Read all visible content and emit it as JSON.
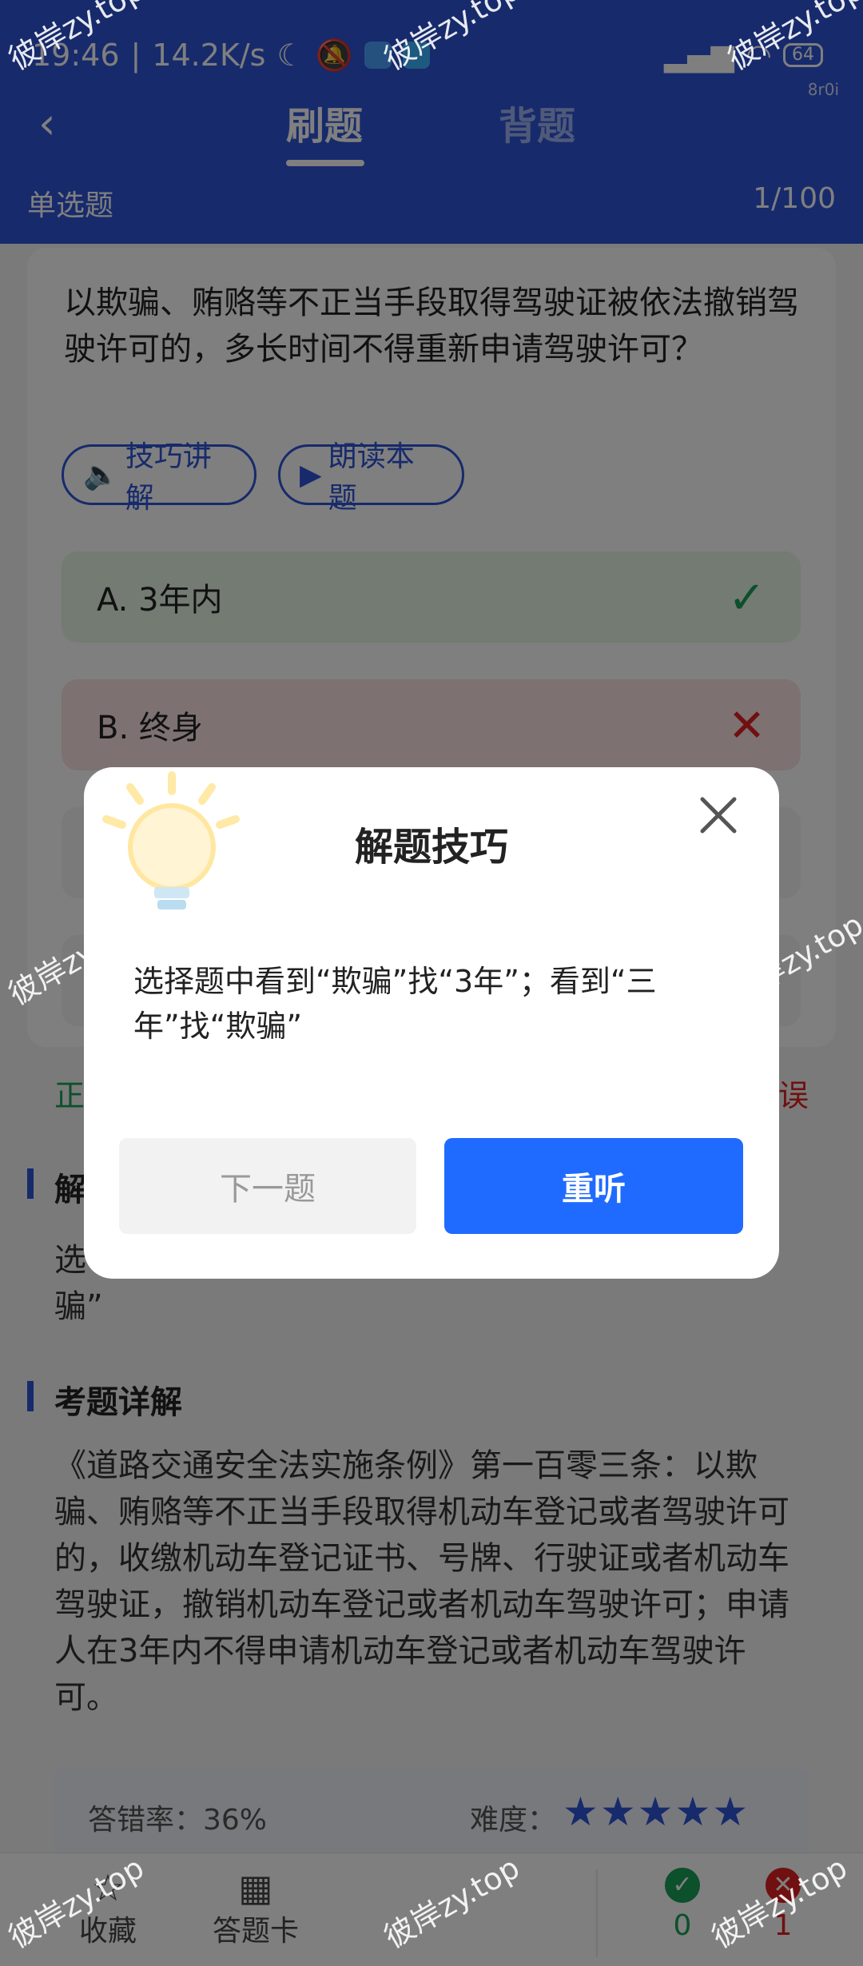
{
  "status": {
    "time": "19:46",
    "speed": "14.2K/s",
    "battery": "64",
    "tag": "8r0i"
  },
  "header": {
    "tabs": [
      "刷题",
      "背题"
    ],
    "question_type": "单选题",
    "progress": "1/100"
  },
  "question": {
    "text": "以欺骗、贿赂等不正当手段取得驾驶证被依法撤销驾驶许可的，多长时间不得重新申请驾驶许可？",
    "tip_button": "技巧讲解",
    "read_button": "朗读本题",
    "options": [
      {
        "label": "A. 3年内",
        "state": "correct"
      },
      {
        "label": "B. 终身",
        "state": "wrong"
      }
    ]
  },
  "result": {
    "correct_prefix": "正",
    "wrong_suffix": "误"
  },
  "explain": {
    "title_prefix": "解",
    "text_visible": "选",
    "text_visible2": "骗”"
  },
  "detail": {
    "title": "考题详解",
    "text": "《道路交通安全法实施条例》第一百零三条：以欺骗、贿赂等不正当手段取得机动车登记或者驾驶许可的，收缴机动车登记证书、号牌、行驶证或者机动车驾驶证，撤销机动车登记或者机动车驾驶许可；申请人在3年内不得申请机动车登记或者机动车驾驶许可。"
  },
  "stats": {
    "error_rate": "答错率：36%",
    "difficulty_label": "难度：",
    "difficulty_stars": 5
  },
  "bottom": {
    "favorite": "收藏",
    "answer_card": "答题卡",
    "correct_count": "0",
    "wrong_count": "1"
  },
  "dialog": {
    "title": "解题技巧",
    "body": "选择题中看到“欺骗”找“3年”；看到“三年”找“欺骗”",
    "next_button": "下一题",
    "replay_button": "重听"
  },
  "watermark": "彼岸zy.top",
  "colors": {
    "primary": "#2f55d8",
    "correct": "#18a058",
    "wrong": "#e02020",
    "button": "#1f6bff"
  }
}
